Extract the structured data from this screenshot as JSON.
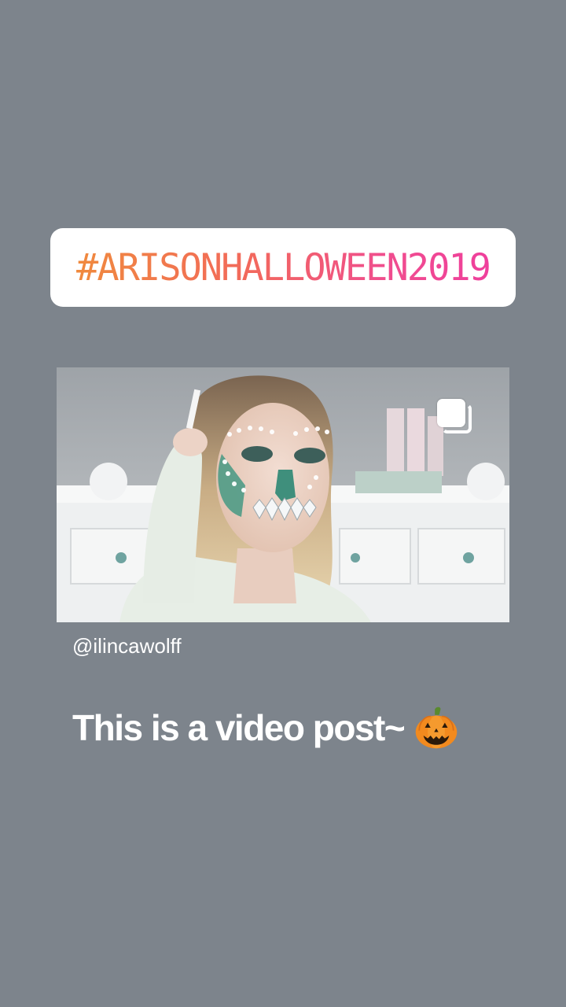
{
  "story": {
    "background_color": "#7d848c",
    "hashtag_sticker": {
      "text": "#ARISONHALLOWEEN2019",
      "gradient_start": "#f08a3e",
      "gradient_end": "#ef3f9c"
    },
    "shared_post": {
      "media_description_icon": "multiple-posts-icon",
      "author": "@ilincawolff"
    },
    "caption": {
      "text": "This is a video post~",
      "emoji": "pumpkin-emoji"
    }
  }
}
